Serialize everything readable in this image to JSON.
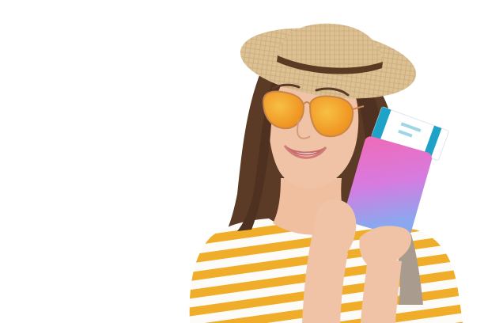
{
  "image": {
    "background_color": "#ffffff",
    "subject": "woman-with-sun-hat-and-orange-sunglasses-holding-passport-and-tickets",
    "colors": {
      "hat": "#d9bd8f",
      "hat_band": "#5a3a22",
      "hair": "#5b3a26",
      "skin": "#f1c3a6",
      "sunglasses_lens": "#f4a21c",
      "sunglasses_frame": "#c9864a",
      "shirt_white": "#fdfbf7",
      "shirt_stripe": "#f0ad2a",
      "passport_top": "#e86fb6",
      "passport_bottom": "#8aa7ef",
      "ticket": "#ffffff",
      "ticket_accent": "#1fa2c8",
      "bag_strap": "#a99c8f"
    }
  }
}
